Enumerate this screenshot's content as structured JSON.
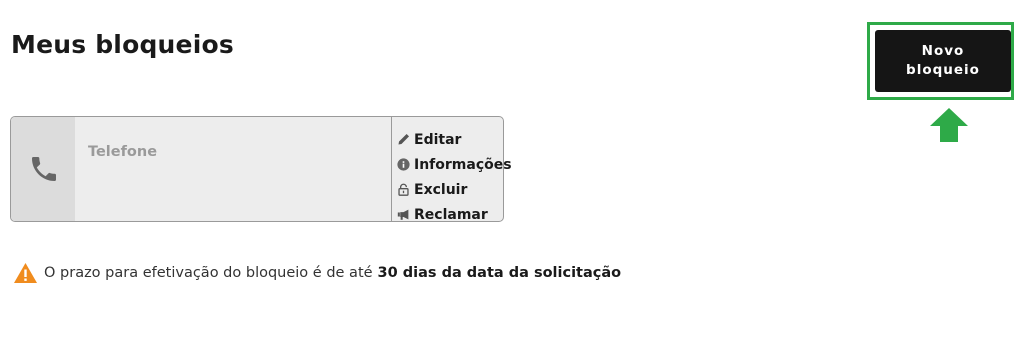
{
  "page": {
    "title": "Meus bloqueios"
  },
  "header": {
    "new_block_button": {
      "label": "Novo bloqueio"
    },
    "highlight_color": "#2eaa48",
    "arrow_icon": "arrow-up-icon"
  },
  "blocks": [
    {
      "label": "Telefone",
      "icon": "phone-icon",
      "actions": [
        {
          "label": "Editar",
          "icon": "pencil-icon"
        },
        {
          "label": "Informações",
          "icon": "info-icon"
        },
        {
          "label": "Excluir",
          "icon": "lock-icon"
        },
        {
          "label": "Reclamar",
          "icon": "megaphone-icon"
        }
      ]
    }
  ],
  "notice": {
    "icon": "warning-icon",
    "icon_color": "#f08c1e",
    "text": "O prazo para efetivação do bloqueio é de até",
    "emphasis": "30 dias da data da solicitação"
  }
}
